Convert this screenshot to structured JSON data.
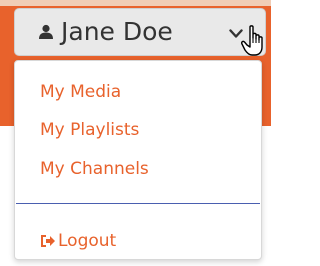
{
  "user_menu": {
    "user_name": "Jane Doe",
    "icons": {
      "user": "user-icon",
      "chevron": "chevron-down-icon",
      "cursor": "hand-pointer-icon",
      "logout": "sign-out-icon"
    },
    "items": [
      {
        "label": "My Media"
      },
      {
        "label": "My Playlists"
      },
      {
        "label": "My Channels"
      }
    ],
    "logout_label": "Logout"
  },
  "colors": {
    "accent": "#e8622c",
    "divider": "#4a5fb0",
    "button_bg": "#e9e9e9"
  }
}
